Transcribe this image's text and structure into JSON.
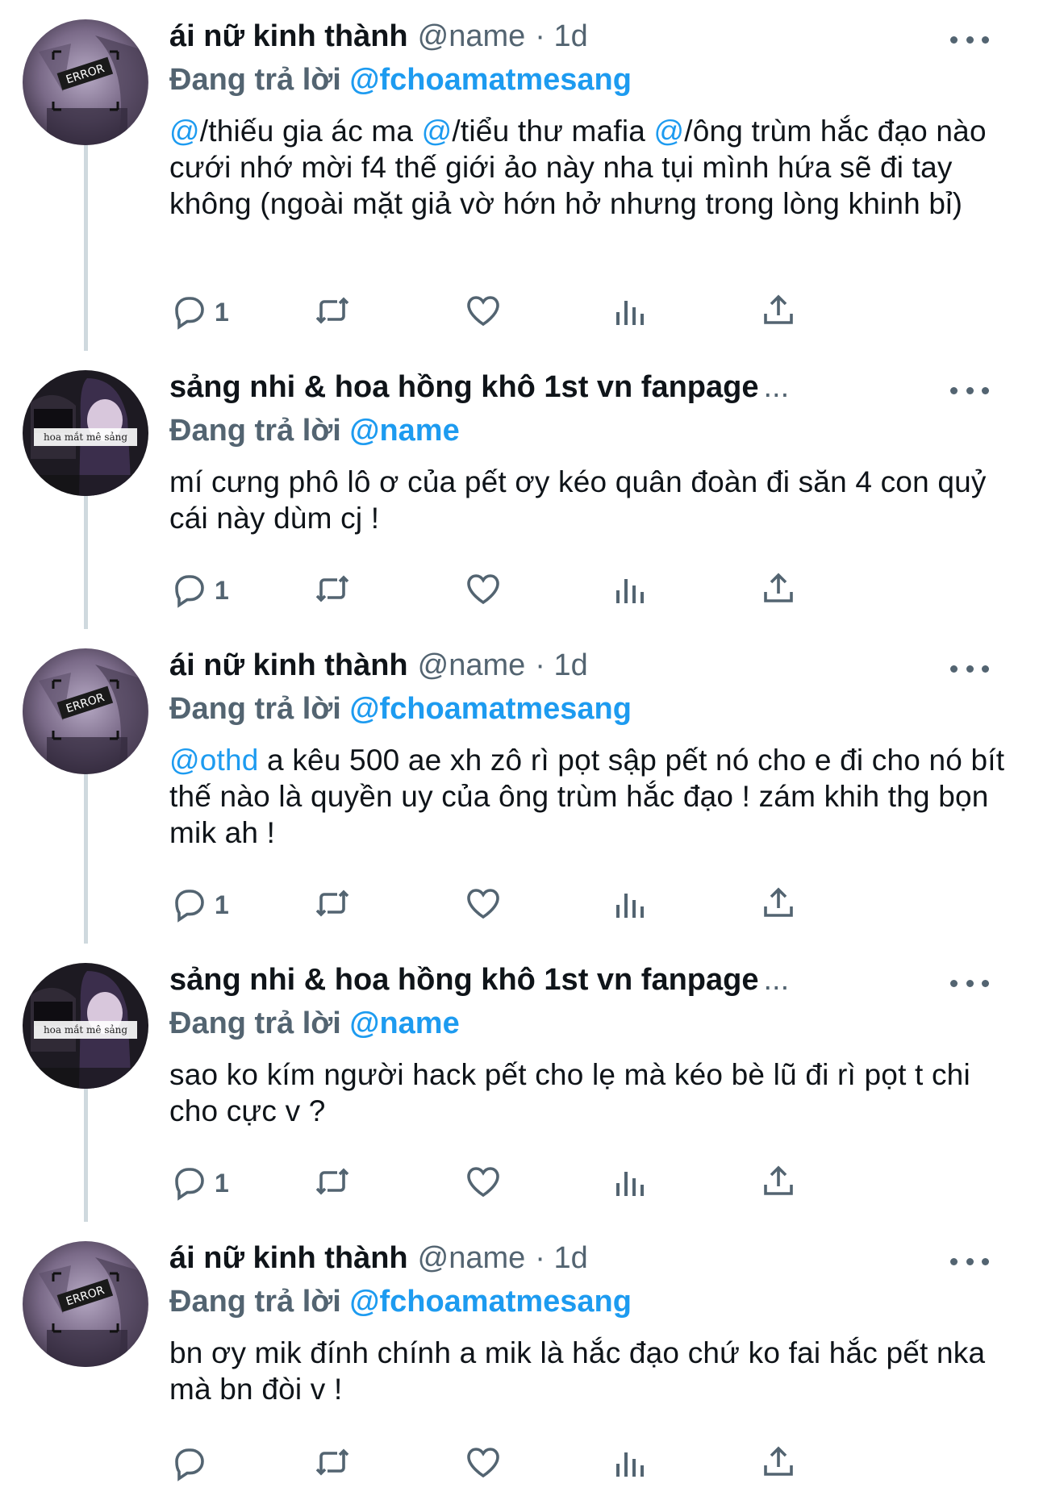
{
  "tweets": [
    {
      "display_name": "ái nữ kinh thành",
      "handle": "@name",
      "time": "· 1d",
      "replying_label": "Đang trả lời",
      "replying_to": "@fchoamatmesang",
      "avatar_text": "ERROR",
      "text_parts": [
        {
          "t": "@",
          "m": true
        },
        {
          "t": "/thiếu gia ác ma ",
          "m": false
        },
        {
          "t": "@",
          "m": true
        },
        {
          "t": "/tiểu thư mafia ",
          "m": false
        },
        {
          "t": "@",
          "m": true
        },
        {
          "t": "/ông trùm hắc đạo nào cưới nhớ mời f4 thế giới ảo này nha tụi mình hứa sẽ đi tay không (ngoài mặt giả vờ hớn hở nhưng trong lòng khinh bỉ)",
          "m": false
        }
      ],
      "reply_count": "1"
    },
    {
      "display_name": "sảng nhi & hoa hồng khô 1st vn fanpage",
      "handle": "",
      "time": "...",
      "replying_label": "Đang trả lời",
      "replying_to": "@name",
      "avatar_text": "hoa mắt mê sảng",
      "text_parts": [
        {
          "t": "mí cưng phô lô ơ của pết ơy kéo quân đoàn đi săn 4 con quỷ cái này dùm cj !",
          "m": false
        }
      ],
      "reply_count": "1"
    },
    {
      "display_name": "ái nữ kinh thành",
      "handle": "@name",
      "time": "· 1d",
      "replying_label": "Đang trả lời",
      "replying_to": "@fchoamatmesang",
      "avatar_text": "ERROR",
      "text_parts": [
        {
          "t": "@othd",
          "m": true
        },
        {
          "t": " a kêu 500 ae xh zô rì pọt sập pết nó cho e đi cho nó bít thế nào là quyền uy của ông trùm hắc đạo ! zám khih thg bọn mik ah !",
          "m": false
        }
      ],
      "reply_count": "1"
    },
    {
      "display_name": "sảng nhi & hoa hồng khô 1st vn fanpage",
      "handle": "",
      "time": "...",
      "replying_label": "Đang trả lời",
      "replying_to": "@name",
      "avatar_text": "hoa mắt mê sảng",
      "text_parts": [
        {
          "t": "sao ko kím người hack pết cho lẹ mà kéo bè lũ đi rì pọt t chi cho cực v ?",
          "m": false
        }
      ],
      "reply_count": "1"
    },
    {
      "display_name": "ái nữ kinh thành",
      "handle": "@name",
      "time": "· 1d",
      "replying_label": "Đang trả lời",
      "replying_to": "@fchoamatmesang",
      "avatar_text": "ERROR",
      "text_parts": [
        {
          "t": "bn ơy mik đính chính a mik là hắc đạo chứ ko fai hắc pết nka mà bn đòi v !",
          "m": false
        }
      ],
      "reply_count": ""
    }
  ],
  "icons": {
    "reply": "reply-icon",
    "retweet": "retweet-icon",
    "like": "heart-icon",
    "views": "views-icon",
    "share": "share-icon",
    "more": "more-icon"
  },
  "colors": {
    "link": "#1d9bf0",
    "secondary": "#536471",
    "thread_line": "#cfd9de",
    "text": "#0f1419"
  }
}
